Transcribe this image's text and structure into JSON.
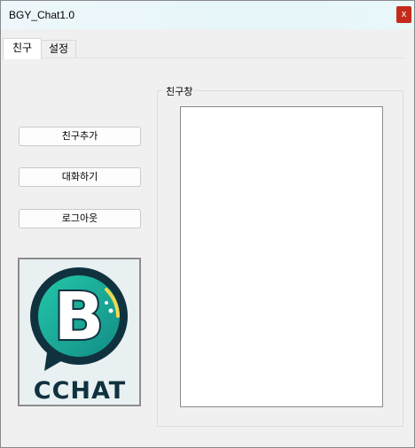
{
  "window": {
    "title": "BGY_Chat1.0",
    "close_label": "x"
  },
  "tabs": [
    {
      "label": "친구",
      "active": true
    },
    {
      "label": "설정",
      "active": false
    }
  ],
  "buttons": {
    "add_friend": "친구추가",
    "chat": "대화하기",
    "logout": "로그아웃"
  },
  "logo": {
    "text": "CCHAT",
    "letter": "B"
  },
  "friend_group": {
    "label": "친구창",
    "items": []
  },
  "colors": {
    "close_bg": "#c42b1c",
    "logo_teal": "#1fb39a",
    "logo_dark": "#0f2f3c"
  }
}
